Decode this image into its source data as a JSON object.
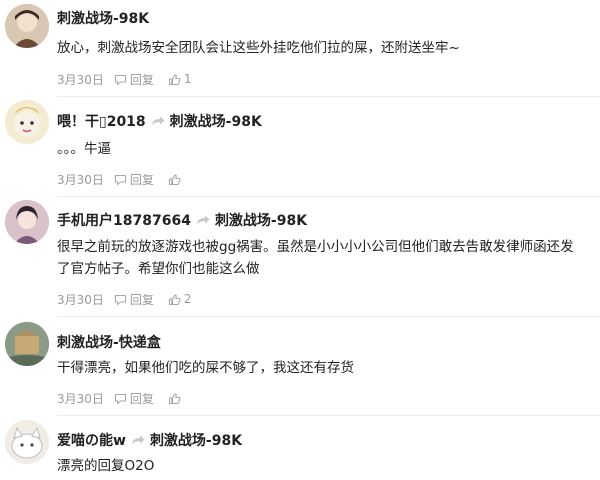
{
  "comments": [
    {
      "user": "刺激战场-98K",
      "reply_to": "",
      "text": "放心，刺激战场安全团队会让这些外挂吃他们拉的屎，还附送坐牢~",
      "date": "3月30日",
      "reply_label": "回复",
      "likes": "1"
    },
    {
      "user": "喂！干▯2018",
      "reply_to": "刺激战场-98K",
      "text": "。。。牛逼",
      "date": "3月30日",
      "reply_label": "回复",
      "likes": ""
    },
    {
      "user": "手机用户18787664",
      "reply_to": "刺激战场-98K",
      "text": "很早之前玩的放逐游戏也被gg祸害。虽然是小小小小公司但他们敢去告敢发律师函还发了官方帖子。希望你们也能这么做",
      "date": "3月30日",
      "reply_label": "回复",
      "likes": "2"
    },
    {
      "user": "刺激战场-快递盒",
      "reply_to": "",
      "text": "干得漂亮，如果他们吃的屎不够了，我这还有存货",
      "date": "3月30日",
      "reply_label": "回复",
      "likes": ""
    },
    {
      "user": "爱喵の能w",
      "reply_to": "刺激战场-98K",
      "text": "漂亮的回复O2O",
      "date": "",
      "reply_label": "",
      "likes": ""
    }
  ],
  "icons": {
    "reply": "speech-bubble-icon",
    "like": "thumbs-up-icon",
    "reply_arrow": "reply-arrow-icon"
  },
  "colors": {
    "meta_text": "#9a9a9a",
    "separator": "#eeeeee"
  }
}
